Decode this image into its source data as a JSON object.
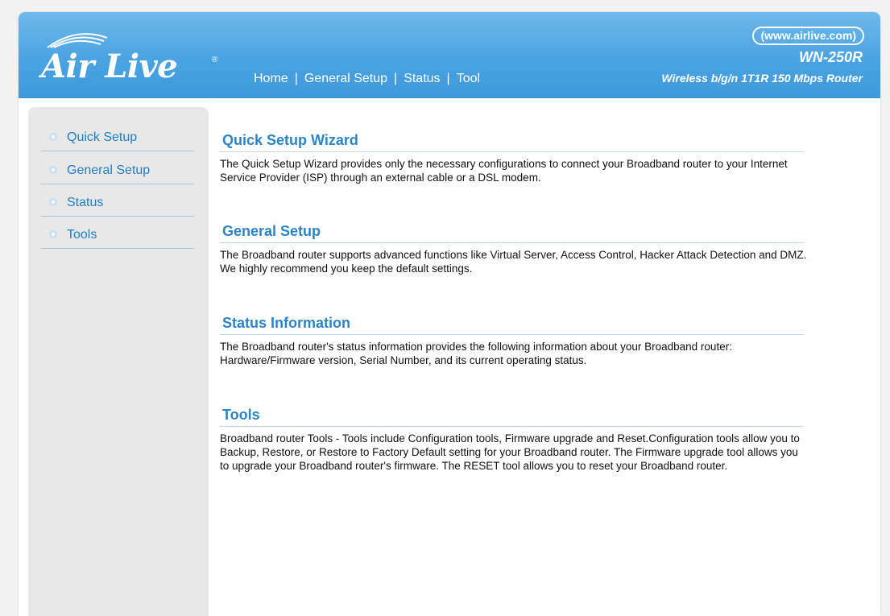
{
  "brand": {
    "logo_text": "Air Live",
    "registered_mark": "®",
    "site_url": "(www.airlive.com)",
    "model": "WN-250R",
    "model_description": "Wireless b/g/n 1T1R 150 Mbps Router"
  },
  "topnav": {
    "items": [
      {
        "label": "Home"
      },
      {
        "label": "General Setup"
      },
      {
        "label": "Status"
      },
      {
        "label": "Tool"
      }
    ],
    "separator": "|"
  },
  "sidebar": {
    "items": [
      {
        "label": "Quick Setup"
      },
      {
        "label": "General Setup"
      },
      {
        "label": "Status"
      },
      {
        "label": "Tools"
      }
    ]
  },
  "sections": [
    {
      "title": "Quick Setup Wizard",
      "body": "The Quick Setup Wizard provides only the necessary configurations to connect your Broadband router to your Internet Service Provider (ISP) through an external cable or a DSL modem."
    },
    {
      "title": "General Setup",
      "body": "The Broadband router supports advanced functions like Virtual Server, Access Control, Hacker Attack Detection and DMZ. We highly recommend you keep the default settings."
    },
    {
      "title": "Status Information",
      "body": "The Broadband router's status information provides the following information about your Broadband router: Hardware/Firmware version, Serial Number, and its current operating status."
    },
    {
      "title": "Tools",
      "body": "Broadband router Tools - Tools include Configuration tools, Firmware upgrade and Reset.Configuration tools allow you to Backup, Restore, or Restore to Factory Default setting for your Broadband router. The Firmware upgrade tool allows you to upgrade your Broadband router's firmware. The RESET tool allows you to reset your Broadband router."
    }
  ],
  "colors": {
    "header_blue": "#4aa3e2",
    "link_blue": "#1f7fc7",
    "heading_blue": "#2a85c7",
    "sidebar_bg": "#e8e8e8"
  }
}
